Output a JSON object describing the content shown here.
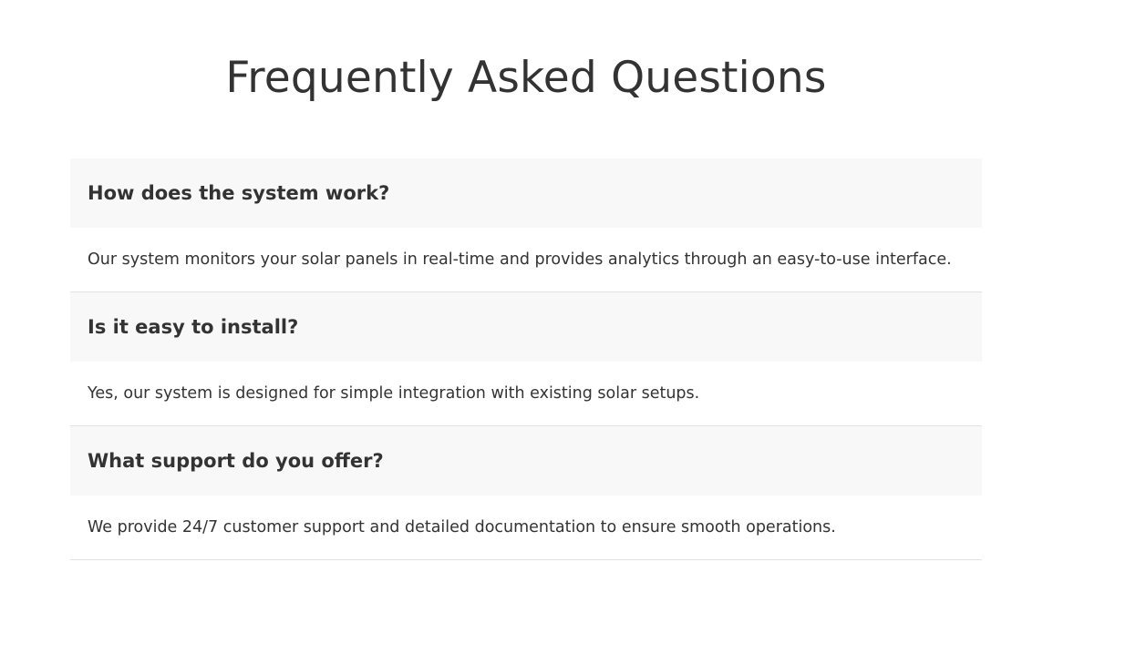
{
  "page": {
    "title": "Frequently Asked Questions"
  },
  "faq": {
    "items": [
      {
        "question": "How does the system work?",
        "answer": "Our system monitors your solar panels in real-time and provides analytics through an easy-to-use interface."
      },
      {
        "question": "Is it easy to install?",
        "answer": "Yes, our system is designed for simple integration with existing solar setups."
      },
      {
        "question": "What support do you offer?",
        "answer": "We provide 24/7 customer support and detailed documentation to ensure smooth operations."
      }
    ]
  },
  "colors": {
    "text": "#333333",
    "question_bg": "#f8f8f8",
    "divider": "#e2e2e2",
    "background": "#ffffff"
  }
}
